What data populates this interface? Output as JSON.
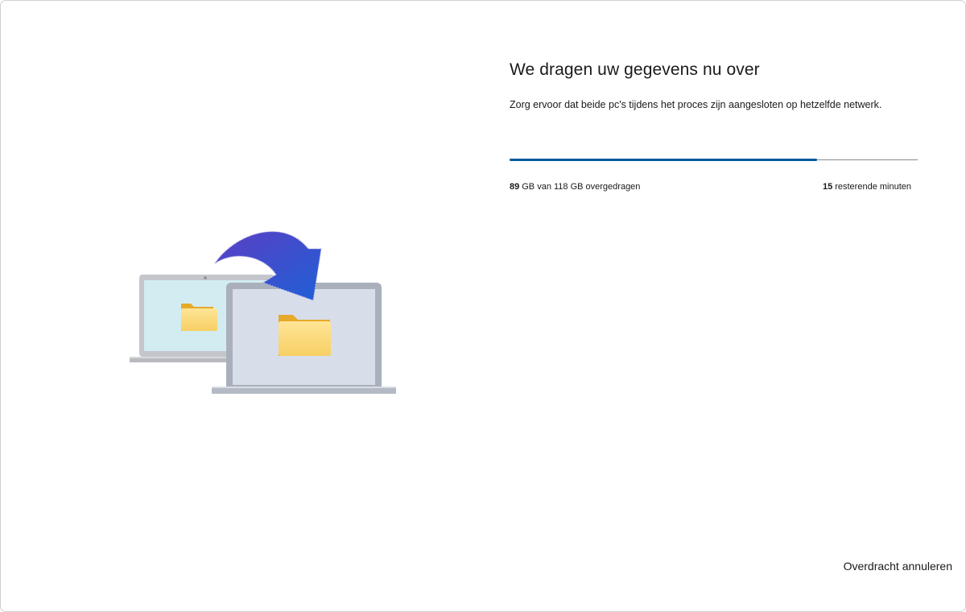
{
  "main": {
    "title": "We dragen uw gegevens nu over",
    "subtitle": "Zorg ervoor dat beide pc's tijdens het proces zijn aangesloten op hetzelfde netwerk."
  },
  "progress": {
    "fraction": 0.754,
    "transferred_amount": "89",
    "transferred_text": "GB van 118 GB overgedragen",
    "remaining_amount": "15",
    "remaining_text": "resterende minuten",
    "color": "#005a9e"
  },
  "footer": {
    "cancel_label": "Overdracht annuleren"
  },
  "illustration": {
    "icons": [
      "source-laptop-icon",
      "target-laptop-icon",
      "transfer-arrow-icon",
      "folder-icon"
    ]
  }
}
